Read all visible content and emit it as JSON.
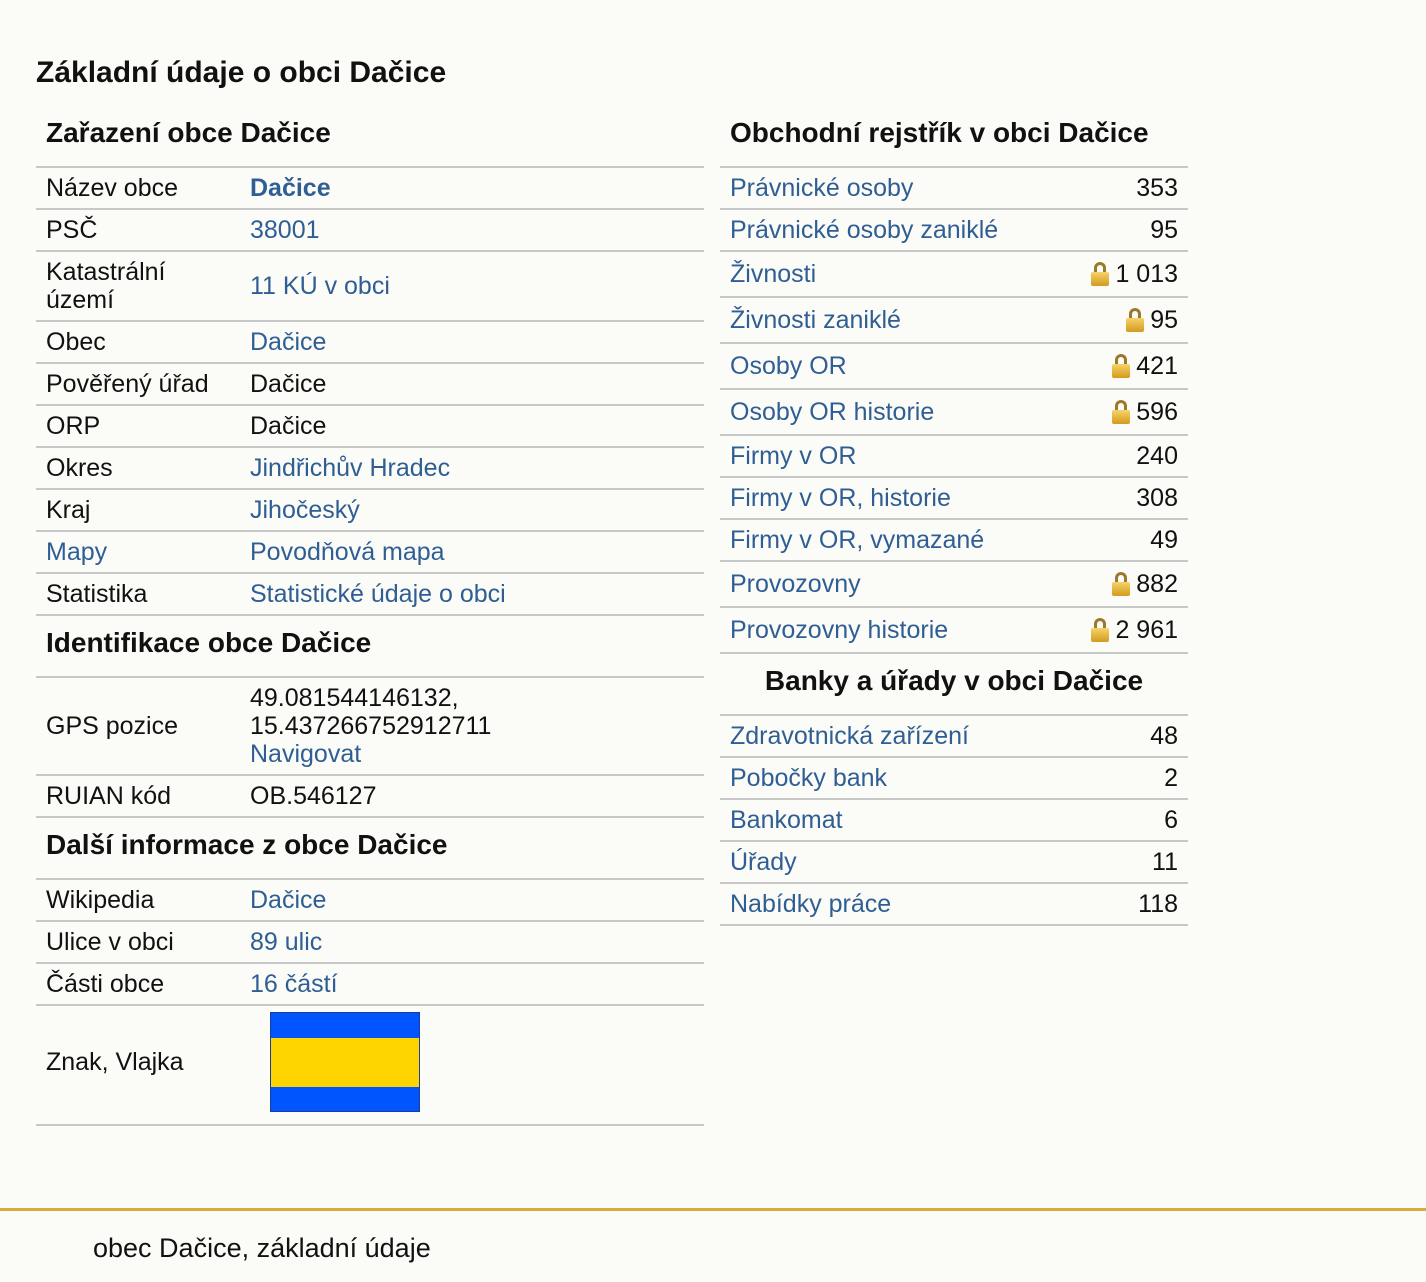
{
  "page_title": "Základní údaje o obci Dačice",
  "classification": {
    "title": "Zařazení obce Dačice",
    "rows": {
      "name": {
        "label": "Název obce",
        "value": "Dačice"
      },
      "psc": {
        "label": "PSČ",
        "value": "38001"
      },
      "katastr": {
        "label": "Katastrální území",
        "value": "11 KÚ v obci"
      },
      "obec": {
        "label": "Obec",
        "value": "Dačice"
      },
      "povereny": {
        "label": "Pověřený úřad",
        "value": "Dačice"
      },
      "orp": {
        "label": "ORP",
        "value": "Dačice"
      },
      "okres": {
        "label": "Okres",
        "value": "Jindřichův Hradec"
      },
      "kraj": {
        "label": "Kraj",
        "value": "Jihočeský"
      },
      "mapy": {
        "label": "Mapy",
        "value": "Povodňová mapa"
      },
      "statistika": {
        "label": "Statistika",
        "value": "Statistické údaje o obci"
      }
    }
  },
  "identification": {
    "title": "Identifikace obce Dačice",
    "gps": {
      "label": "GPS pozice",
      "line1": "49.081544146132,",
      "line2": "15.437266752912711",
      "nav": "Navigovat"
    },
    "ruian": {
      "label": "RUIAN kód",
      "value": "OB.546127"
    }
  },
  "more": {
    "title": "Další informace z obce Dačice",
    "wikipedia": {
      "label": "Wikipedia",
      "value": "Dačice"
    },
    "streets": {
      "label": "Ulice v obci",
      "value": "89 ulic"
    },
    "parts": {
      "label": "Části obce",
      "value": "16 částí"
    },
    "emblem": {
      "label": "Znak, Vlajka"
    },
    "flag_colors": [
      "#0055ff",
      "#ffd500",
      "#0055ff"
    ]
  },
  "registry": {
    "title": "Obchodní rejstřík v obci Dačice",
    "items": [
      {
        "label": "Právnické osoby",
        "value": "353",
        "locked": false
      },
      {
        "label": "Právnické osoby zaniklé",
        "value": "95",
        "locked": false
      },
      {
        "label": "Živnosti",
        "value": "1 013",
        "locked": true
      },
      {
        "label": "Živnosti zaniklé",
        "value": "95",
        "locked": true
      },
      {
        "label": "Osoby OR",
        "value": "421",
        "locked": true
      },
      {
        "label": "Osoby OR historie",
        "value": "596",
        "locked": true
      },
      {
        "label": "Firmy v OR",
        "value": "240",
        "locked": false
      },
      {
        "label": "Firmy v OR, historie",
        "value": "308",
        "locked": false
      },
      {
        "label": "Firmy v OR, vymazané",
        "value": "49",
        "locked": false
      },
      {
        "label": "Provozovny",
        "value": "882",
        "locked": true
      },
      {
        "label": "Provozovny historie",
        "value": "2 961",
        "locked": true
      }
    ]
  },
  "banks": {
    "title": "Banky a úřady v obci Dačice",
    "items": [
      {
        "label": "Zdravotnická zařízení",
        "value": "48"
      },
      {
        "label": "Pobočky bank",
        "value": "2"
      },
      {
        "label": "Bankomat",
        "value": "6"
      },
      {
        "label": "Úřady",
        "value": "11"
      },
      {
        "label": "Nabídky práce",
        "value": "118"
      }
    ]
  },
  "footer": {
    "text": "obec Dačice, základní údaje"
  },
  "colors": {
    "link": "#2f5e94",
    "footer_line": "#d6ad3c",
    "lock_icon": "padlock-icon"
  }
}
